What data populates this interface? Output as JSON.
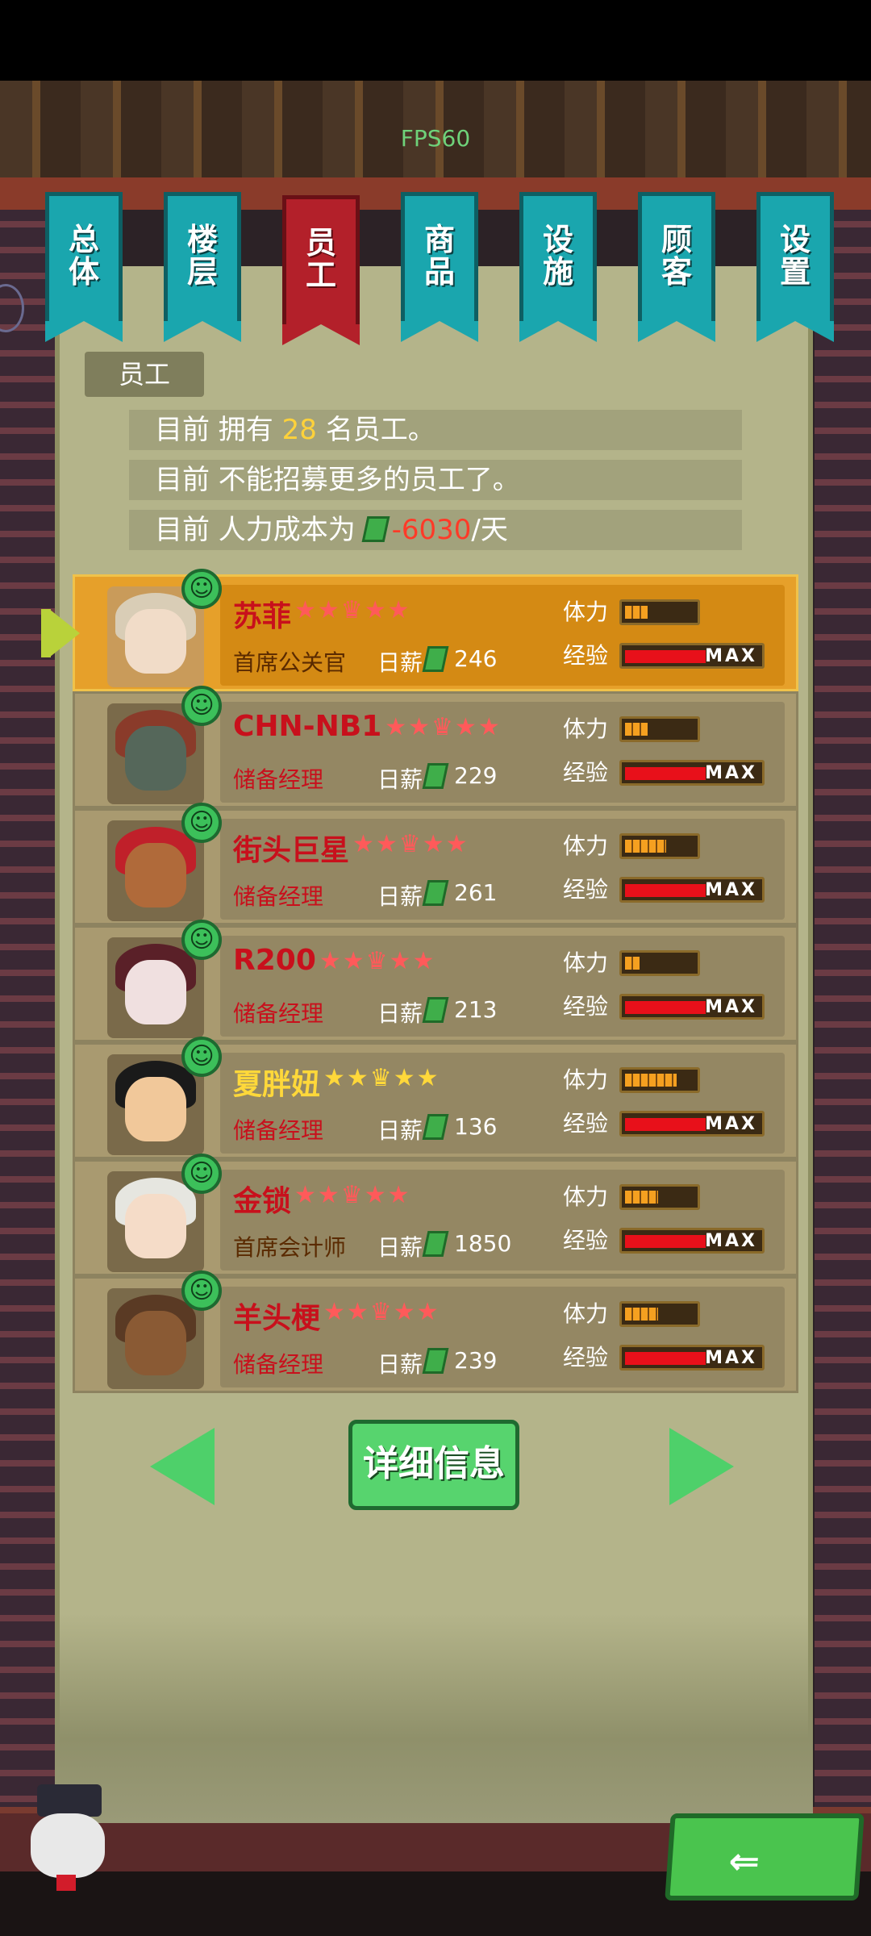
{
  "hud": {
    "fps": "FPS60"
  },
  "tabs": [
    {
      "label": [
        "总",
        "体"
      ],
      "active": false
    },
    {
      "label": [
        "楼",
        "层"
      ],
      "active": false
    },
    {
      "label": [
        "员",
        "工"
      ],
      "active": true
    },
    {
      "label": [
        "商",
        "品"
      ],
      "active": false
    },
    {
      "label": [
        "设",
        "施"
      ],
      "active": false
    },
    {
      "label": [
        "顾",
        "客"
      ],
      "active": false
    },
    {
      "label": [
        "设",
        "置"
      ],
      "active": false
    }
  ],
  "section": {
    "title": "员工",
    "line1": {
      "pre": "目前 拥有 ",
      "count": "28",
      "post": " 名员工。"
    },
    "line2": "目前 不能招募更多的员工了。",
    "line3": {
      "pre": "目前 人力成本为 ",
      "cost": "-6030",
      "post": "/天"
    }
  },
  "labels": {
    "stamina": "体力",
    "exp": "经验",
    "wage": "日薪",
    "max": "MAX"
  },
  "staff": [
    {
      "name": "苏菲",
      "role": "首席公关官",
      "wage": "246",
      "stars": "★★♛★★",
      "stamina": 0.3,
      "selected": true
    },
    {
      "name": "CHN-NB1",
      "role": "储备经理",
      "wage": "229",
      "stars": "★★♛★★",
      "stamina": 0.3,
      "selected": false
    },
    {
      "name": "街头巨星",
      "role": "储备经理",
      "wage": "261",
      "stars": "★★♛★★",
      "stamina": 0.55,
      "selected": false
    },
    {
      "name": "R200",
      "role": "储备经理",
      "wage": "213",
      "stars": "★★♛★★",
      "stamina": 0.2,
      "selected": false
    },
    {
      "name": "夏胖妞",
      "role": "储备经理",
      "wage": "136",
      "stars": "★★♛★★",
      "stamina": 0.7,
      "selected": false,
      "gold": true
    },
    {
      "name": "金锁",
      "role": "首席会计师",
      "wage": "1850",
      "stars": "★★♛★★",
      "stamina": 0.45,
      "selected": false
    },
    {
      "name": "羊头梗",
      "role": "储备经理",
      "wage": "239",
      "stars": "★★♛★★",
      "stamina": 0.45,
      "selected": false
    }
  ],
  "buttons": {
    "detail": "详细信息"
  },
  "colors": {
    "panel": "#b4b48a",
    "tab": "#1aa6ae",
    "tab_active": "#b3202a",
    "accent_green": "#4ed06a"
  }
}
